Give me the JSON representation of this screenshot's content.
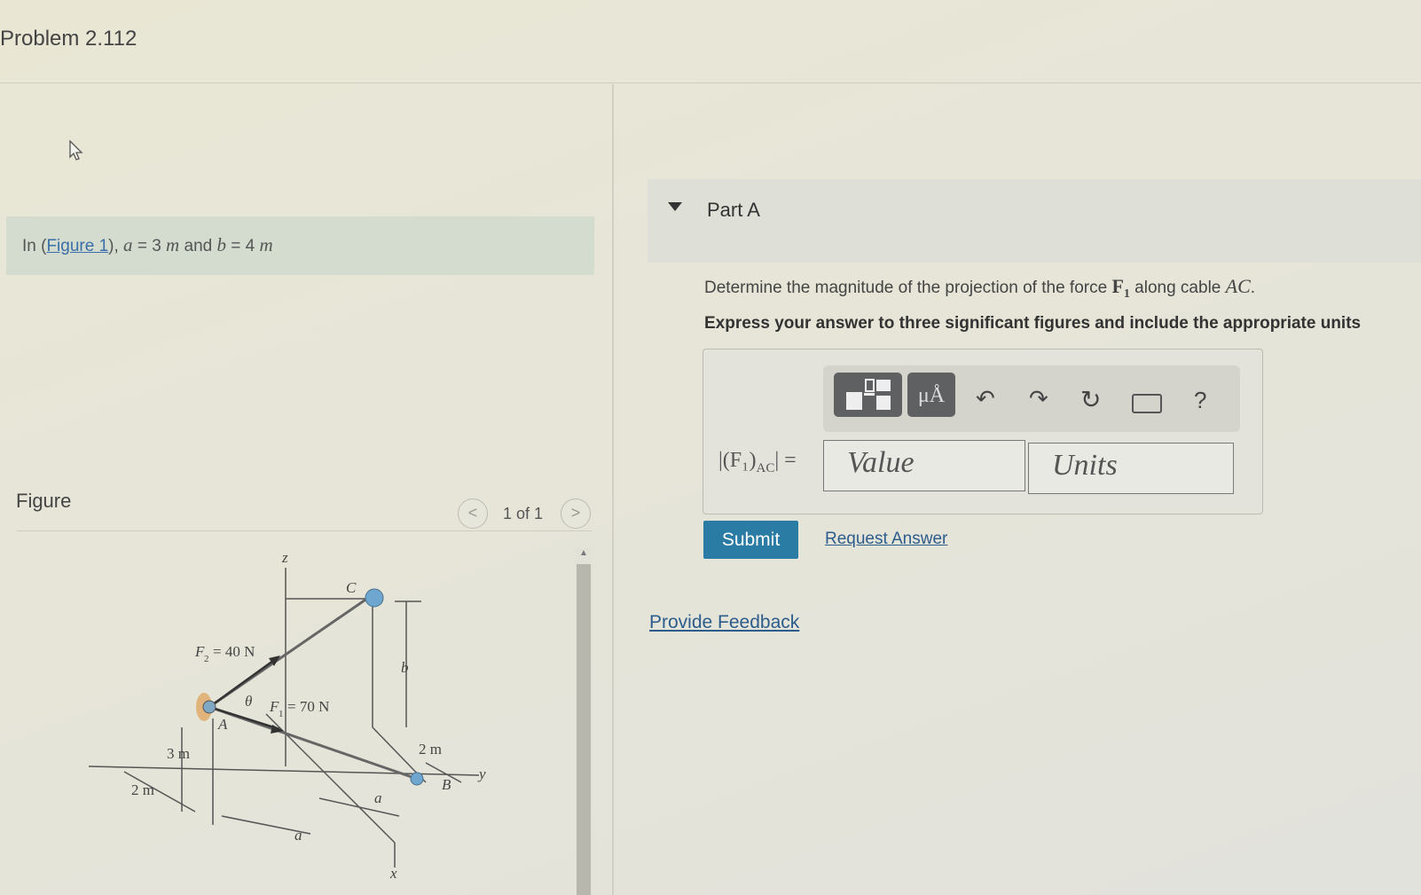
{
  "problem": {
    "title": "Problem 2.112"
  },
  "intro": {
    "prefix": "In (",
    "figure_link": "Figure 1",
    "suffix_1": "), ",
    "var_a": "a",
    "eq_a": " = 3 ",
    "unit_a": "m",
    "and": " and ",
    "var_b": "b",
    "eq_b": " = 4 ",
    "unit_b": "m"
  },
  "figure": {
    "label": "Figure",
    "pager": {
      "text": "1 of 1",
      "prev": "<",
      "next": ">"
    },
    "labels": {
      "z": "z",
      "C": "C",
      "F2": "F",
      "F2_sub": "2",
      "F2_val": "= 40 N",
      "theta": "θ",
      "F1": "F",
      "F1_sub": "1",
      "F1_val": "= 70 N",
      "A": "A",
      "b": "b",
      "dim_3m": "3 m",
      "dim_2m_left": "2 m",
      "dim_2m_right": "2 m",
      "B": "B",
      "y": "y",
      "a1": "a",
      "a2": "a",
      "x": "x"
    }
  },
  "part_a": {
    "title": "Part A",
    "question_pre": "Determine the magnitude of the projection of the force ",
    "question_force": "F",
    "question_force_sub": "1",
    "question_mid": " along cable ",
    "question_cable": "AC",
    "question_end": ".",
    "instruction": "Express your answer to three significant figures and include the appropriate units",
    "answer_label": "|(F₁)",
    "answer_label_sub": "AC",
    "answer_label_end": "| =",
    "value_placeholder": "Value",
    "units_placeholder": "Units",
    "toolbar": {
      "symbols": "μÅ",
      "help": "?"
    },
    "submit": "Submit",
    "request_answer": "Request Answer"
  },
  "feedback": {
    "link": "Provide Feedback"
  },
  "colors": {
    "accent": "#2a7ca5",
    "link": "#2c5c8c",
    "intro_bg": "#d3dccf"
  }
}
